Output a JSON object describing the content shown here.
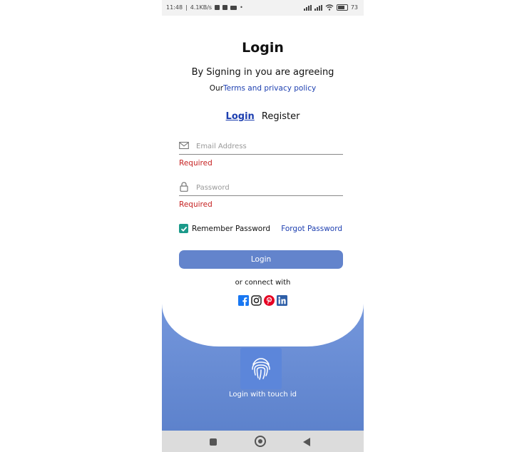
{
  "status_bar": {
    "time": "11:48",
    "speed": "4.1KB/s",
    "battery": "73"
  },
  "card": {
    "title": "Login",
    "subtitle": "By Signing in you are agreeing",
    "terms_prefix": "Our",
    "terms_link": "Terms and privacy policy"
  },
  "tabs": {
    "login": "Login",
    "register": "Register"
  },
  "form": {
    "email_placeholder": "Email Address",
    "email_value": "",
    "email_error": "Required",
    "password_placeholder": "Password",
    "password_value": "",
    "password_error": "Required",
    "remember_label": "Remember Password",
    "remember_checked": true,
    "forgot_label": "Forgot Password",
    "login_button": "Login"
  },
  "social": {
    "connect_label": "or connect with",
    "icons": [
      "facebook-icon",
      "instagram-icon",
      "pinterest-icon",
      "linkedin-icon"
    ]
  },
  "touch": {
    "label": "Login with touch id"
  },
  "colors": {
    "accent": "#6384cc",
    "link": "#1d3fb0",
    "error": "#c62222",
    "checkbox": "#1b9a8a",
    "background_gradient_top": "#7a9ce0",
    "background_gradient_bottom": "#5d82cc"
  }
}
